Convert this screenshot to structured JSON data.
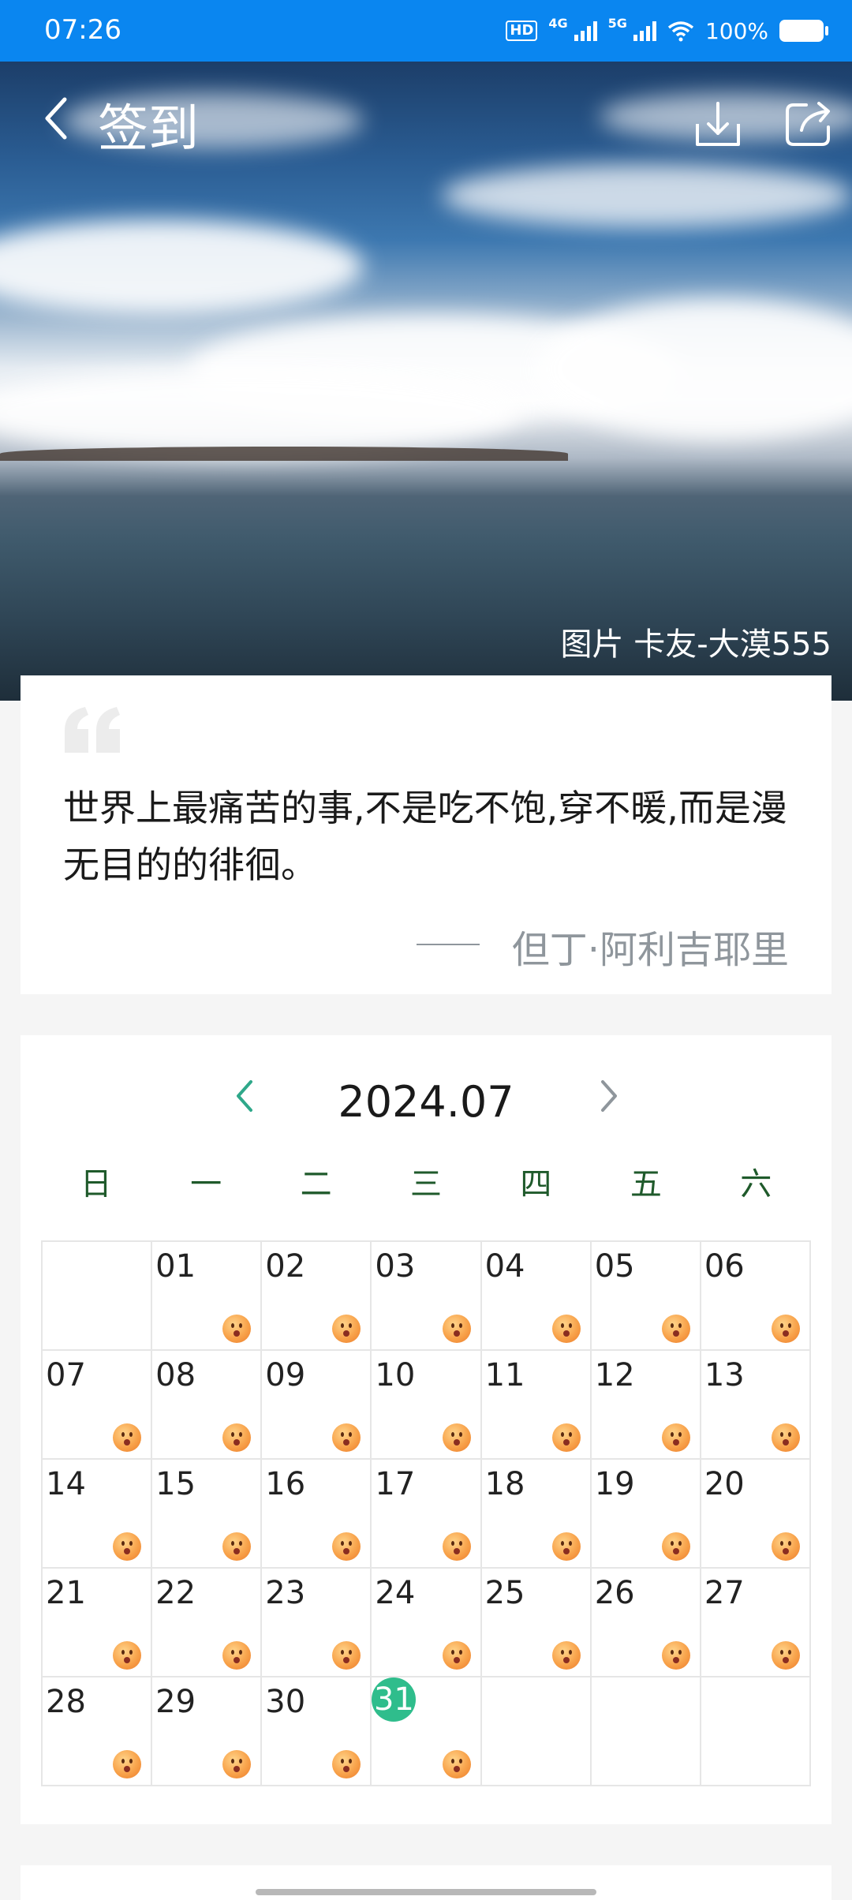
{
  "status_bar": {
    "time": "07:26",
    "hd_label": "HD",
    "net1": "4G",
    "net2": "5G",
    "battery": "100%"
  },
  "header": {
    "title": "签到",
    "photo_credit": "图片 卡友-大漠555"
  },
  "quote": {
    "text": "世界上最痛苦的事,不是吃不饱,穿不暖,而是漫无目的的徘徊。",
    "author": "但丁·阿利吉耶里"
  },
  "calendar": {
    "month": "2024.07",
    "weekdays": [
      "日",
      "一",
      "二",
      "三",
      "四",
      "五",
      "六"
    ],
    "days": [
      {
        "label": "",
        "mood": false
      },
      {
        "label": "01",
        "mood": true
      },
      {
        "label": "02",
        "mood": true
      },
      {
        "label": "03",
        "mood": true
      },
      {
        "label": "04",
        "mood": true
      },
      {
        "label": "05",
        "mood": true
      },
      {
        "label": "06",
        "mood": true
      },
      {
        "label": "07",
        "mood": true
      },
      {
        "label": "08",
        "mood": true
      },
      {
        "label": "09",
        "mood": true
      },
      {
        "label": "10",
        "mood": true
      },
      {
        "label": "11",
        "mood": true
      },
      {
        "label": "12",
        "mood": true
      },
      {
        "label": "13",
        "mood": true
      },
      {
        "label": "14",
        "mood": true
      },
      {
        "label": "15",
        "mood": true
      },
      {
        "label": "16",
        "mood": true
      },
      {
        "label": "17",
        "mood": true
      },
      {
        "label": "18",
        "mood": true
      },
      {
        "label": "19",
        "mood": true
      },
      {
        "label": "20",
        "mood": true
      },
      {
        "label": "21",
        "mood": true
      },
      {
        "label": "22",
        "mood": true
      },
      {
        "label": "23",
        "mood": true
      },
      {
        "label": "24",
        "mood": true
      },
      {
        "label": "25",
        "mood": true
      },
      {
        "label": "26",
        "mood": true
      },
      {
        "label": "27",
        "mood": true
      },
      {
        "label": "28",
        "mood": true
      },
      {
        "label": "29",
        "mood": true
      },
      {
        "label": "30",
        "mood": true
      },
      {
        "label": "31",
        "mood": true,
        "today": true
      },
      {
        "label": "",
        "mood": false
      },
      {
        "label": "",
        "mood": false
      },
      {
        "label": "",
        "mood": false
      }
    ],
    "mood_icon": "smiling-face-icon"
  },
  "colors": {
    "status_bar": "#0a86f0",
    "accent_green": "#2fbd8c",
    "weekday_text": "#1f5a2b",
    "nav_arrow_prev": "#2fa88a",
    "nav_arrow_next": "#8f969c",
    "quote_author": "#8f969c",
    "mood_orange": "#f8a24a"
  }
}
